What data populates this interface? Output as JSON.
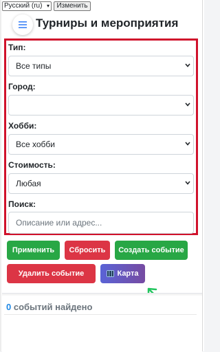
{
  "lang": {
    "selected": "Русский (ru)",
    "apply_label": "Изменить"
  },
  "header": {
    "title": "Турниры и мероприятия"
  },
  "filters": {
    "type": {
      "label": "Тип:",
      "value": "Все типы"
    },
    "city": {
      "label": "Город:",
      "value": ""
    },
    "hobby": {
      "label": "Хобби:",
      "value": "Все хобби"
    },
    "cost": {
      "label": "Стоимость:",
      "value": "Любая"
    },
    "search": {
      "label": "Поиск:",
      "placeholder": "Описание или адрес..."
    }
  },
  "actions": {
    "apply": "Применить",
    "reset": "Сбросить",
    "create": "Создать событие",
    "delete": "Удалить событие",
    "map": "Карта"
  },
  "results": {
    "count": "0",
    "text": " событий найдено"
  },
  "colors": {
    "highlight": "#d0112b",
    "green": "#28a745",
    "red": "#dc3545",
    "accent": "#1e88e5",
    "arrow": "#22c55e"
  }
}
